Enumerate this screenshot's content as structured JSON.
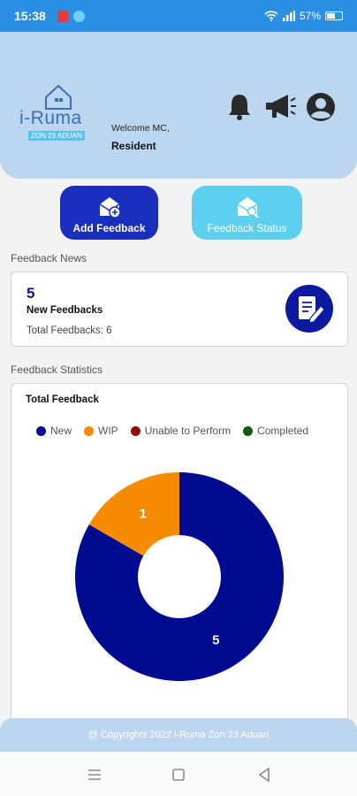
{
  "status_bar": {
    "time": "15:38",
    "battery": "57%",
    "battery_level": 0.57
  },
  "header": {
    "logo_name": "i-Ruma",
    "logo_tagline": "ZON 23 ADUAN",
    "welcome": "Welcome MC,",
    "role": "Resident",
    "icons": [
      "bell-icon",
      "megaphone-icon",
      "account-icon"
    ]
  },
  "actions": {
    "add_feedback": "Add Feedback",
    "feedback_status": "Feedback Status"
  },
  "news": {
    "section_title": "Feedback News",
    "count": "5",
    "label": "New Feedbacks",
    "total": "Total Feedbacks: 6"
  },
  "stats": {
    "section_title": "Feedback Statistics",
    "card_title": "Total Feedback"
  },
  "chart_data": {
    "type": "pie",
    "title": "Total Feedback",
    "legend_position": "top",
    "donut": true,
    "series": [
      {
        "name": "New",
        "value": 5,
        "color": "#000b8f"
      },
      {
        "name": "WIP",
        "value": 1,
        "color": "#f68b00"
      },
      {
        "name": "Unable to Perform",
        "value": 0,
        "color": "#8b0a0a"
      },
      {
        "name": "Completed",
        "value": 0,
        "color": "#0e5a0e"
      }
    ]
  },
  "footer": {
    "copyright": "@ Copyrights 2022 i-Ruma Zon 23 Aduan"
  }
}
